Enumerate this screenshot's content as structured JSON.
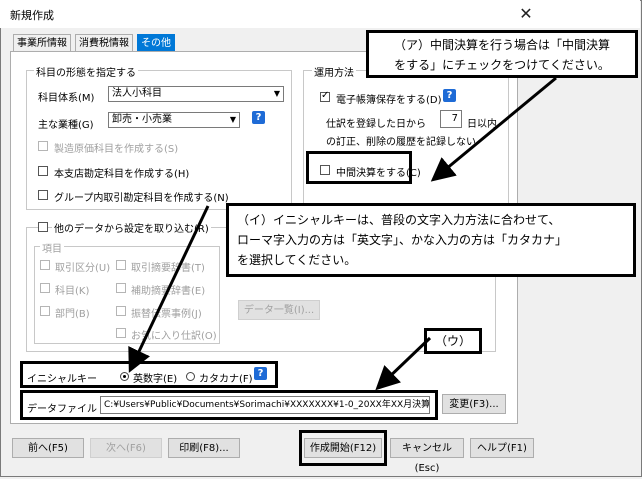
{
  "window": {
    "title": "新規作成",
    "close_glyph": "✕"
  },
  "tabs": [
    {
      "label": "事業所情報"
    },
    {
      "label": "消費税情報"
    },
    {
      "label": "その他"
    }
  ],
  "subject_group": {
    "title": "科目の形態を指定する",
    "system_label": "科目体系(M)",
    "system_value": "法人小科目",
    "industry_label": "主な業種(G)",
    "industry_value": "卸売・小売業",
    "cb_manufacturing": "製造原価科目を作成する(S)",
    "cb_head_branch": "本支店勘定科目を作成する(H)",
    "cb_group": "グループ内取引勘定科目を作成する(N)"
  },
  "operation_group": {
    "title": "運用方法",
    "cb_ebook": "電子帳簿保存をする(D)",
    "entry_after_label": "仕訳を登録した日から",
    "entry_days": "7",
    "entry_after_suffix": "日以内",
    "entry_history": "の訂正、削除の履歴を記録しない",
    "cb_interim": "中間決算をする(C)"
  },
  "other_data_group": {
    "title": "他のデータから設定を取り込む(R)",
    "items_label": "項目",
    "items": [
      "取引区分(U)",
      "取引摘要辞書(T)",
      "科目(K)",
      "補助摘要辞書(E)",
      "部門(B)",
      "振替伝票事例(J)",
      "お気に入り仕訳(O)"
    ],
    "data_list_button": "データ一覧(I)..."
  },
  "initial_key": {
    "label": "イニシャルキー",
    "opt_alnum": "英数字(E)",
    "opt_katakana": "カタカナ(F)"
  },
  "data_file": {
    "label": "データファイル",
    "path": "C:¥Users¥Public¥Documents¥Sorimachi¥XXXXXXX¥1-0_20XX年XX月決算_",
    "change_button": "変更(F3)..."
  },
  "footer": {
    "prev": "前へ(F5)",
    "next": "次へ(F6)",
    "print": "印刷(F8)...",
    "create": "作成開始(F12)",
    "cancel": "キャンセル(Esc)",
    "help": "ヘルプ(F1)"
  },
  "callouts": {
    "a_line1": "（ア）中間決算を行う場合は「中間決算",
    "a_line2": "をする」にチェックをつけてください。",
    "i_line1": "（イ）イニシャルキーは、普段の文字入力方法に合わせて、",
    "i_line2": "ローマ字入力の方は「英文字」、かな入力の方は「カタカナ」",
    "i_line3": "を選択してください。",
    "u_label": "（ウ）"
  },
  "help_glyph": "?"
}
